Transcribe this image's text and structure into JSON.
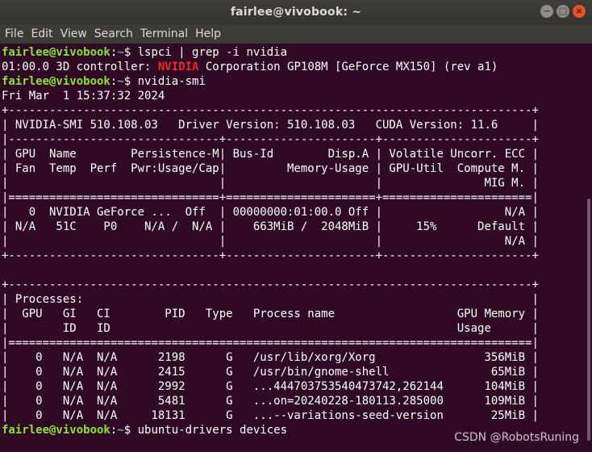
{
  "window": {
    "title": "fairlee@vivobook: ~",
    "btn_minimize": "−",
    "btn_maximize": "□",
    "btn_close": "×"
  },
  "menu": [
    "File",
    "Edit",
    "View",
    "Search",
    "Terminal",
    "Help"
  ],
  "prompt": {
    "user": "fairlee@vivobook",
    "sep": ":",
    "path": "~",
    "symbol": "$ "
  },
  "terminal": {
    "cmd1": "lspci | grep -i nvidia",
    "out1_pre": "01:00.0 3D controller: ",
    "out1_hl": "NVIDIA",
    "out1_post": " Corporation GP108M [GeForce MX150] (rev a1)",
    "cmd2": "nvidia-smi",
    "smi": [
      "Fri Mar  1 15:37:32 2024",
      "+-----------------------------------------------------------------------------+",
      "| NVIDIA-SMI 510.108.03   Driver Version: 510.108.03   CUDA Version: 11.6     |",
      "|-------------------------------+----------------------+----------------------+",
      "| GPU  Name        Persistence-M| Bus-Id        Disp.A | Volatile Uncorr. ECC |",
      "| Fan  Temp  Perf  Pwr:Usage/Cap|         Memory-Usage | GPU-Util  Compute M. |",
      "|                               |                      |               MIG M. |",
      "|===============================+======================+======================|",
      "|   0  NVIDIA GeForce ...  Off  | 00000000:01:00.0 Off |                  N/A |",
      "| N/A   51C    P0    N/A /  N/A |    663MiB /  2048MiB |     15%      Default |",
      "|                               |                      |                  N/A |",
      "+-------------------------------+----------------------+----------------------+",
      "",
      "+-----------------------------------------------------------------------------+",
      "| Processes:                                                                  |",
      "|  GPU   GI   CI        PID   Type   Process name                  GPU Memory |",
      "|        ID   ID                                                   Usage      |",
      "|=============================================================================|",
      "|    0   N/A  N/A      2198      G   /usr/lib/xorg/Xorg                356MiB |",
      "|    0   N/A  N/A      2415      G   /usr/bin/gnome-shell               65MiB |",
      "|    0   N/A  N/A      2992      G   ...444703753540473742,262144      104MiB |",
      "|    0   N/A  N/A      5481      G   ...on=20240228-180113.285000      109MiB |",
      "|    0   N/A  N/A     18131      G   ...--variations-seed-version       25MiB |"
    ],
    "cmd3": "ubuntu-drivers devices"
  },
  "watermark": "CSDN @RobotsRuning"
}
